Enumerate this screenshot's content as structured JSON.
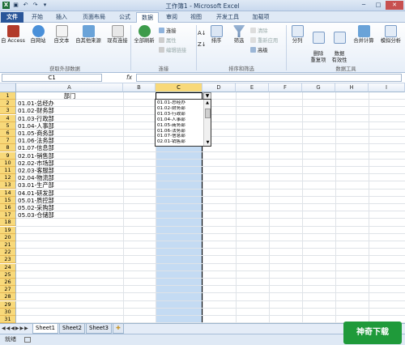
{
  "window": {
    "title": "工作簿1 - Microsoft Excel"
  },
  "ribbon_tabs": [
    "文件",
    "开始",
    "插入",
    "页面布局",
    "公式",
    "数据",
    "审阅",
    "视图",
    "开发工具",
    "加载项"
  ],
  "active_tab": "数据",
  "ribbon": {
    "group_external": {
      "label": "获取外部数据",
      "access": "自 Access",
      "web": "自网站",
      "text": "自文本",
      "other": "自其他来源",
      "existing": "现有连接"
    },
    "group_connections": {
      "label": "连接",
      "refresh": "全部刷新",
      "connections": "连接",
      "properties": "属性",
      "edit_links": "编辑链接"
    },
    "group_sort": {
      "label": "排序和筛选",
      "sort": "排序",
      "filter": "筛选",
      "clear": "清除",
      "reapply": "重新应用",
      "advanced": "高级"
    },
    "group_tools": {
      "label": "数据工具",
      "split": "分列",
      "remove_dup": "删除\n重复项",
      "validation": "数据\n有效性",
      "consolidate": "合并计算",
      "whatif": "模拟分析"
    }
  },
  "formula_bar": {
    "name_box": "C1",
    "fx": "fx",
    "value": ""
  },
  "columns": [
    "A",
    "B",
    "C",
    "D",
    "E",
    "F",
    "G",
    "H",
    "I"
  ],
  "rows": [
    "1",
    "2",
    "3",
    "4",
    "5",
    "6",
    "7",
    "8",
    "9",
    "10",
    "11",
    "12",
    "13",
    "14",
    "15",
    "16",
    "17",
    "18",
    "19",
    "20",
    "21",
    "22",
    "23",
    "24",
    "25",
    "26",
    "27",
    "28",
    "29",
    "30",
    "31"
  ],
  "cells_a": [
    "部门",
    "01.01-总经办",
    "01.02-财务部",
    "01.03-行政部",
    "01.04-人事部",
    "01.05-商务部",
    "01.06-法务部",
    "01.07-信息部",
    "02.01-销售部",
    "02.02-市场部",
    "02.03-客服部",
    "02.04-物流部",
    "03.01-生产部",
    "04.01-研发部",
    "05.01-质控部",
    "05.02-采购部",
    "05.03-仓储部"
  ],
  "dropdown_items": [
    "01.01-总经办",
    "01.02-财务部",
    "01.03-行政部",
    "01.04-人事部",
    "01.05-商务部",
    "01.06-法务部",
    "01.07-信息部",
    "02.01-销售部"
  ],
  "sheets": [
    "Sheet1",
    "Sheet2",
    "Sheet3"
  ],
  "active_sheet": "Sheet1",
  "status": "就绪",
  "watermark": "神奇下载"
}
